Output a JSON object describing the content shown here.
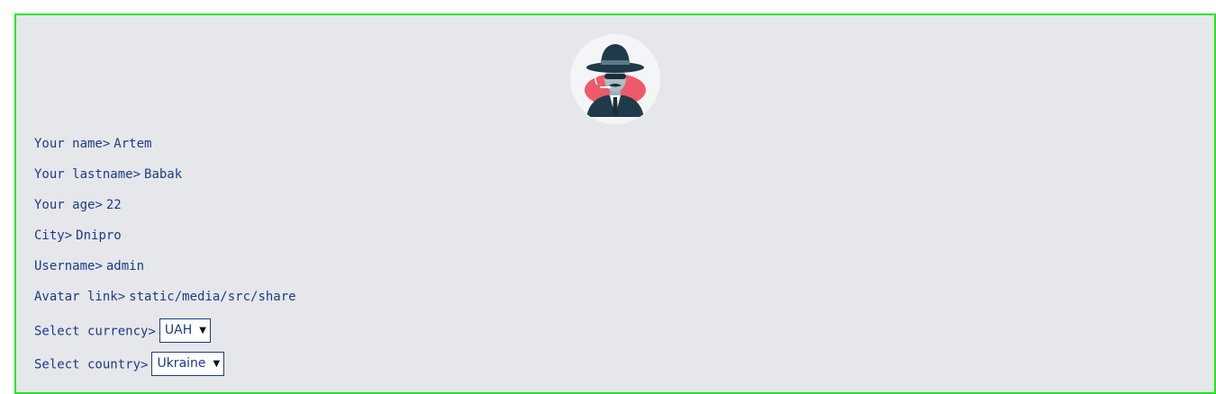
{
  "profile": {
    "avatar_icon": "spy-avatar-icon",
    "fields": [
      {
        "label": "Your name",
        "value": "Artem"
      },
      {
        "label": "Your lastname",
        "value": "Babak"
      },
      {
        "label": "Your age",
        "value": "22"
      },
      {
        "label": "City",
        "value": "Dnipro"
      },
      {
        "label": "Username",
        "value": "admin"
      },
      {
        "label": "Avatar link",
        "value": "static/media/src/share"
      }
    ],
    "currency": {
      "label": "Select currency",
      "selected": "UAH"
    },
    "country": {
      "label": "Select country",
      "selected": "Ukraine"
    },
    "separator": ">"
  },
  "colors": {
    "panel_border": "#1ee81e",
    "panel_bg": "#e6e7ea",
    "text": "#1d3a8a"
  }
}
